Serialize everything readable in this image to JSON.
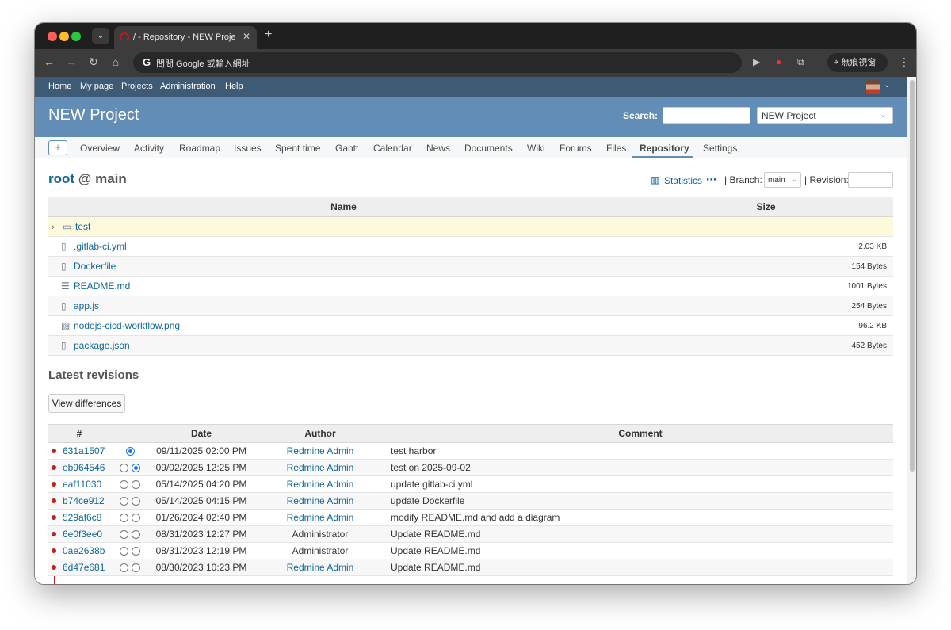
{
  "browser": {
    "tab_title": "/ - Repository - NEW Project - Redmine",
    "tab_close": "✕",
    "new_tab": "+",
    "omnibox_placeholder": "問問 Google 或輸入網址",
    "incognito_label": "無痕視窗"
  },
  "topmenu": {
    "items": [
      "Home",
      "My page",
      "Projects",
      "Administration",
      "Help"
    ]
  },
  "header": {
    "project_title": "NEW Project",
    "search_label": "Search:",
    "project_select_value": "NEW Project"
  },
  "mainmenu": {
    "new_button": "+",
    "items": [
      "Overview",
      "Activity",
      "Roadmap",
      "Issues",
      "Spent time",
      "Gantt",
      "Calendar",
      "News",
      "Documents",
      "Wiki",
      "Forums",
      "Files",
      "Repository",
      "Settings"
    ],
    "selected": "Repository"
  },
  "repo": {
    "title_root": "root",
    "title_rest": "@ main",
    "statistics_label": "Statistics",
    "more": "⋯",
    "branch_label": "| Branch:",
    "branch_value": "main",
    "revision_label": "| Revision:"
  },
  "entries": {
    "headers": {
      "name": "Name",
      "size": "Size"
    },
    "rows": [
      {
        "name": "test",
        "size": "",
        "type": "dir",
        "icon": "folder-icon"
      },
      {
        "name": ".gitlab-ci.yml",
        "size": "2.03 KB",
        "type": "file",
        "icon": "file-icon"
      },
      {
        "name": "Dockerfile",
        "size": "154 Bytes",
        "type": "file",
        "icon": "file-icon"
      },
      {
        "name": "README.md",
        "size": "1001 Bytes",
        "type": "file",
        "icon": "text-file-icon"
      },
      {
        "name": "app.js",
        "size": "254 Bytes",
        "type": "file",
        "icon": "js-file-icon"
      },
      {
        "name": "nodejs-cicd-workflow.png",
        "size": "96.2 KB",
        "type": "file",
        "icon": "image-file-icon"
      },
      {
        "name": "package.json",
        "size": "452 Bytes",
        "type": "file",
        "icon": "file-icon"
      }
    ]
  },
  "latest": {
    "title": "Latest revisions",
    "view_differences": "View differences",
    "headers": {
      "num": "#",
      "date": "Date",
      "author": "Author",
      "comment": "Comment"
    },
    "rows": [
      {
        "rev": "631a1507",
        "date": "09/11/2025 02:00 PM",
        "author": "Redmine Admin",
        "author_link": true,
        "comment": "test harbor",
        "radio1": null,
        "radio2": true
      },
      {
        "rev": "eb964546",
        "date": "09/02/2025 12:25 PM",
        "author": "Redmine Admin",
        "author_link": true,
        "comment": "test on 2025-09-02",
        "radio1": false,
        "radio2": true
      },
      {
        "rev": "eaf11030",
        "date": "05/14/2025 04:20 PM",
        "author": "Redmine Admin",
        "author_link": true,
        "comment": "update gitlab-ci.yml",
        "radio1": false,
        "radio2": false
      },
      {
        "rev": "b74ce912",
        "date": "05/14/2025 04:15 PM",
        "author": "Redmine Admin",
        "author_link": true,
        "comment": "update Dockerfile",
        "radio1": false,
        "radio2": false
      },
      {
        "rev": "529af6c8",
        "date": "01/26/2024 02:40 PM",
        "author": "Redmine Admin",
        "author_link": true,
        "comment": "modify README.md and add a diagram",
        "radio1": false,
        "radio2": false
      },
      {
        "rev": "6e0f3ee0",
        "date": "08/31/2023 12:27 PM",
        "author": "Administrator",
        "author_link": false,
        "comment": "Update README.md",
        "radio1": false,
        "radio2": false
      },
      {
        "rev": "0ae2638b",
        "date": "08/31/2023 12:19 PM",
        "author": "Administrator",
        "author_link": false,
        "comment": "Update README.md",
        "radio1": false,
        "radio2": false
      },
      {
        "rev": "6d47e681",
        "date": "08/30/2023 10:23 PM",
        "author": "Redmine Admin",
        "author_link": true,
        "comment": "Update README.md",
        "radio1": false,
        "radio2": false
      }
    ]
  },
  "colors": {
    "header_bg": "#628db6",
    "topmenu_bg": "#3e5b76",
    "link": "#116699",
    "graph": "#c21f1f"
  }
}
